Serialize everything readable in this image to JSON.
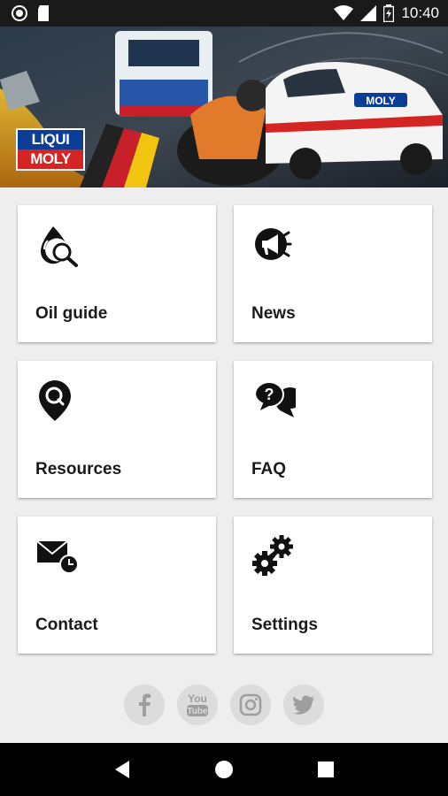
{
  "status_bar": {
    "time": "10:40"
  },
  "banner": {
    "logo_line1": "LIQUI",
    "logo_line2": "MOLY",
    "car_badge": "MOLY"
  },
  "menu": {
    "oil_guide": "Oil guide",
    "news": "News",
    "resources": "Resources",
    "faq": "FAQ",
    "contact": "Contact",
    "settings": "Settings"
  },
  "icons": {
    "oil_guide": "oil-drop-search-icon",
    "news": "megaphone-icon",
    "resources": "map-pin-search-icon",
    "faq": "question-chat-icon",
    "contact": "mail-clock-icon",
    "settings": "gears-icon"
  },
  "social": [
    "facebook",
    "youtube",
    "instagram",
    "twitter"
  ],
  "colors": {
    "logo_blue": "#0b3c96",
    "logo_red": "#d42424",
    "background": "#eeeeee",
    "tile": "#ffffff"
  }
}
